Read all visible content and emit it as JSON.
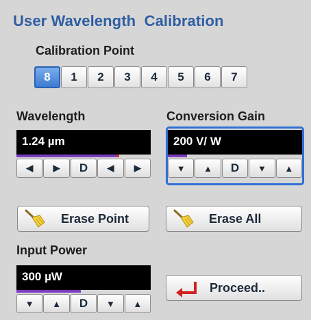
{
  "title": "User Wavelength  Calibration",
  "calibration_point": {
    "label": "Calibration Point",
    "buttons": [
      "8",
      "1",
      "2",
      "3",
      "4",
      "5",
      "6",
      "7"
    ],
    "selected": "8"
  },
  "wavelength": {
    "label": "Wavelength",
    "value": "1.24 µm",
    "controls": [
      "◀",
      "▶",
      "D",
      "◀",
      "▶"
    ]
  },
  "conversion_gain": {
    "label": "Conversion Gain",
    "value": "200 V/ W",
    "controls": [
      "▼",
      "▲",
      "D",
      "▼",
      "▲"
    ]
  },
  "buttons": {
    "erase_point": "Erase Point",
    "erase_all": "Erase All",
    "proceed": "Proceed.."
  },
  "input_power": {
    "label": "Input Power",
    "value": "300 µW",
    "controls": [
      "▼",
      "▲",
      "D",
      "▼",
      "▲"
    ]
  },
  "colors": {
    "title": "#2f5ea3",
    "selected_button": "#3d7bd1",
    "display_bg": "#000000",
    "level_bar": "#7a3cc0",
    "focus_frame": "#2f6fd6",
    "proceed_arrow": "#d42020"
  },
  "icons": {
    "erase": "broom-icon",
    "proceed": "enter-arrow-icon"
  }
}
